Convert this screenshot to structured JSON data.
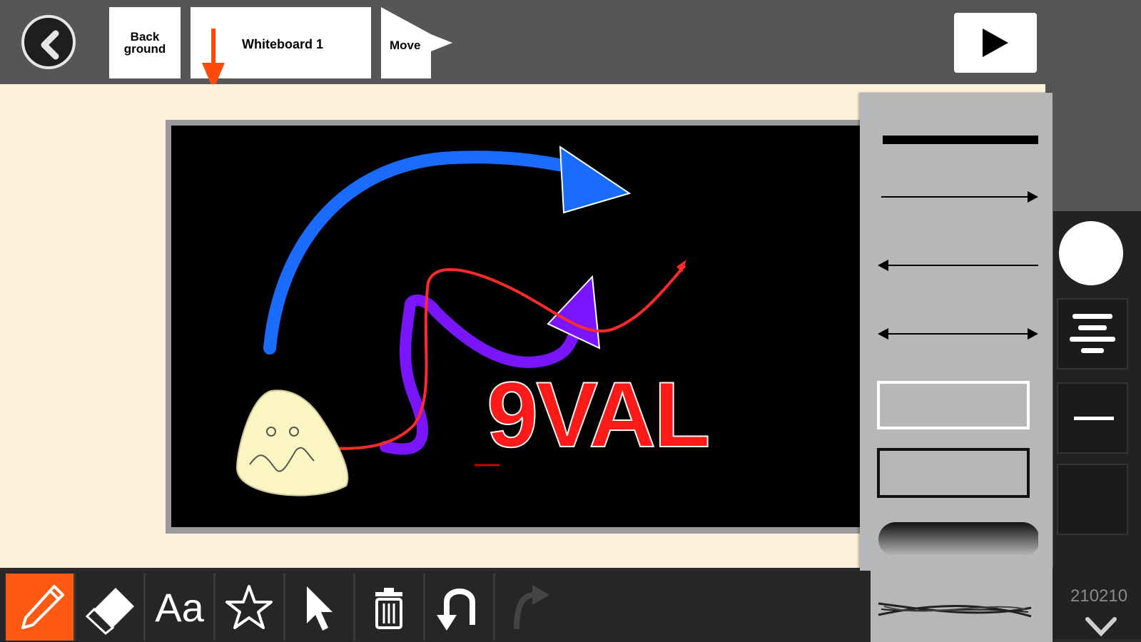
{
  "topbar": {
    "background_tab": {
      "line1": "Back",
      "line2": "ground"
    },
    "whiteboard_tab": {
      "label": "Whiteboard 1"
    },
    "move_tab": {
      "label": "Move"
    },
    "back_icon": "chevron-left-icon",
    "play_icon": "play-icon"
  },
  "board": {
    "text": "9VAL"
  },
  "line_styles": [
    {
      "name": "thick-line"
    },
    {
      "name": "arrow-right"
    },
    {
      "name": "arrow-left"
    },
    {
      "name": "arrow-both"
    },
    {
      "name": "outlined-white"
    },
    {
      "name": "outlined-black"
    },
    {
      "name": "gradient-stroke"
    },
    {
      "name": "sketch-stroke"
    }
  ],
  "side_panel": {
    "color": "#ffffff",
    "alignment_icon": "align-center-icon",
    "line_icon": "line-width-icon"
  },
  "toolbar": {
    "tools": [
      "pencil-icon",
      "eraser-icon",
      "text-tool",
      "star-icon",
      "pointer-icon",
      "trash-icon",
      "undo-icon",
      "redo-icon"
    ],
    "text_tool_label": "Aa"
  },
  "page_number": "210210",
  "colors": {
    "accent": "#ff5a12",
    "topbar": "#565656",
    "canvas": "#fdf1dc"
  }
}
